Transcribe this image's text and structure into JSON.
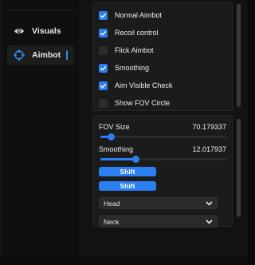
{
  "nav": {
    "items": [
      {
        "label": "Visuals",
        "icon": "eye-icon",
        "active": false
      },
      {
        "label": "Aimbot",
        "icon": "crosshair-icon",
        "active": true
      }
    ]
  },
  "aimbot": {
    "checkboxes": [
      {
        "label": "Normal Aimbot",
        "checked": true
      },
      {
        "label": "Recoil control",
        "checked": true
      },
      {
        "label": "Flick Aimbot",
        "checked": false
      },
      {
        "label": "Smoothing",
        "checked": true
      },
      {
        "label": "Aim Visible Check",
        "checked": true
      },
      {
        "label": "Show FOV Circle",
        "checked": false
      }
    ],
    "sliders": [
      {
        "label": "FOV Size",
        "value": "70.179337",
        "fraction": 0.08
      },
      {
        "label": "Smoothing",
        "value": "12.017937",
        "fraction": 0.28
      }
    ],
    "keybinds": [
      "Shift",
      "Shift"
    ],
    "selects": [
      {
        "value": "Head"
      },
      {
        "value": "Neck"
      }
    ]
  },
  "colors": {
    "accent": "#2b7ff0",
    "panel": "#1b1b1b",
    "background": "#121212"
  }
}
